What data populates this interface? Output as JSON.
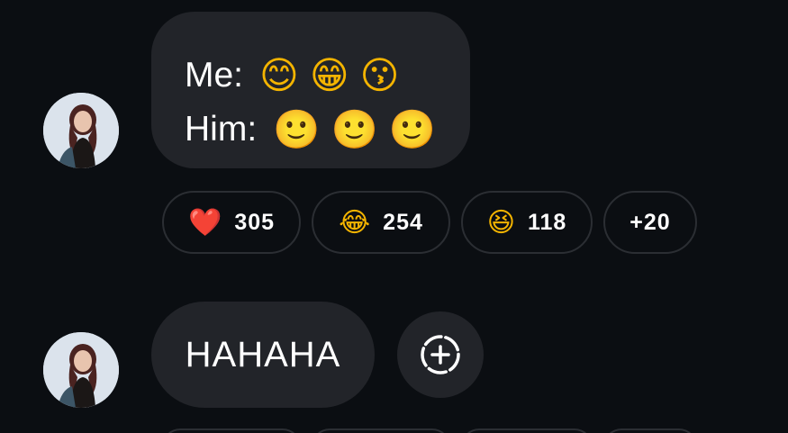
{
  "messages": [
    {
      "lines": [
        {
          "label": "Me:",
          "emojis": [
            "😊",
            "😁",
            "😗"
          ]
        },
        {
          "label": "Him:",
          "emojis": [
            "🙂",
            "🙂",
            "🙂"
          ]
        }
      ],
      "reactions": [
        {
          "emoji": "❤️",
          "icon": "red-heart-icon",
          "count": "305"
        },
        {
          "emoji": "😂",
          "icon": "face-with-tears-of-joy-icon",
          "count": "254"
        },
        {
          "emoji": "😆",
          "icon": "grinning-squinting-face-icon",
          "count": "118"
        },
        {
          "emoji": "",
          "icon": "",
          "count": "+20"
        }
      ]
    },
    {
      "text": "HAHAHA",
      "add_reaction_icon": "add-reaction-icon"
    }
  ],
  "colors": {
    "background": "#0b0e12",
    "bubble": "#222429",
    "chip_border": "#2b2e33",
    "text": "#ffffff"
  }
}
